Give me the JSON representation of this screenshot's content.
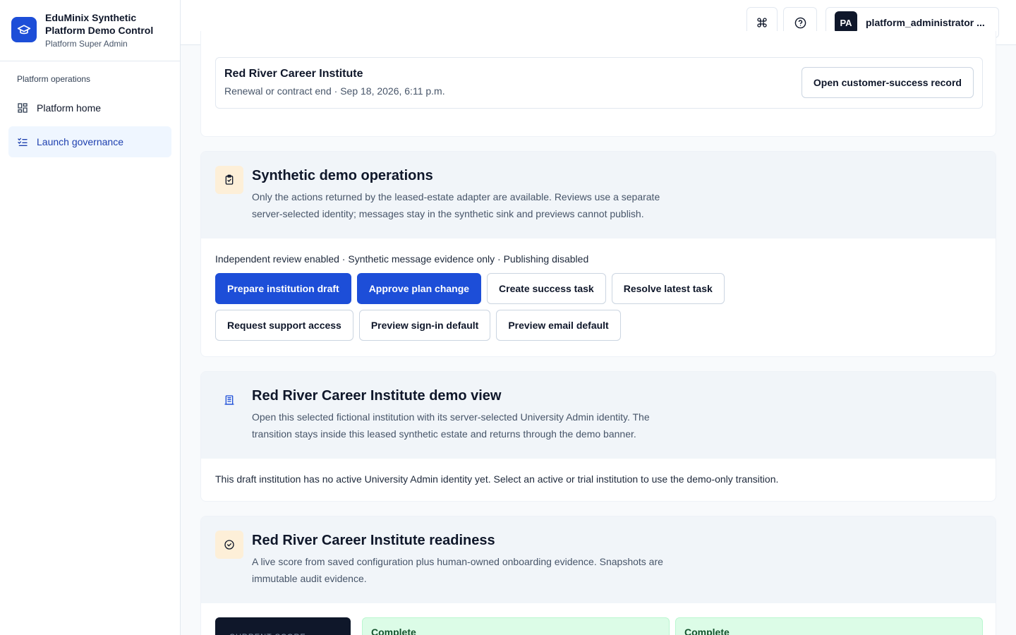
{
  "brand": {
    "title": "EduMinix Synthetic Platform Demo Control",
    "subtitle": "Platform Super Admin"
  },
  "sidebar": {
    "section_heading": "Platform operations",
    "items": [
      {
        "label": "Platform home",
        "icon": "grid-icon",
        "active": false
      },
      {
        "label": "Launch governance",
        "icon": "checklist-icon",
        "active": true
      }
    ]
  },
  "topbar": {
    "command_icon": "command-icon",
    "help_icon": "help-circle-icon",
    "user_initials": "PA",
    "user_name": "platform_administrator ..."
  },
  "record": {
    "name": "Red River Career Institute",
    "meta": "Renewal or contract end · Sep 18, 2026, 6:11 p.m.",
    "button": "Open customer-success record"
  },
  "demo_ops": {
    "title": "Synthetic demo operations",
    "description": "Only the actions returned by the leased-estate adapter are available. Reviews use a separate server-selected identity; messages stay in the synthetic sink and previews cannot publish.",
    "status_line": "Independent review enabled · Synthetic message evidence only · Publishing disabled",
    "buttons": [
      {
        "label": "Prepare institution draft",
        "primary": true
      },
      {
        "label": "Approve plan change",
        "primary": true
      },
      {
        "label": "Create success task",
        "primary": false
      },
      {
        "label": "Resolve latest task",
        "primary": false
      },
      {
        "label": "Request support access",
        "primary": false
      },
      {
        "label": "Preview sign-in default",
        "primary": false
      },
      {
        "label": "Preview email default",
        "primary": false
      }
    ]
  },
  "demo_view": {
    "title": "Red River Career Institute demo view",
    "description": "Open this selected fictional institution with its server-selected University Admin identity. The transition stays inside this leased synthetic estate and returns through the demo banner.",
    "notice": "This draft institution has no active University Admin identity yet. Select an active or trial institution to use the demo-only transition."
  },
  "readiness": {
    "title": "Red River Career Institute readiness",
    "description": "A live score from saved configuration plus human-owned onboarding evidence. Snapshots are immutable audit evidence.",
    "score_label": "CURRENT SCORE",
    "complete_1": "Complete",
    "complete_2": "Complete"
  }
}
